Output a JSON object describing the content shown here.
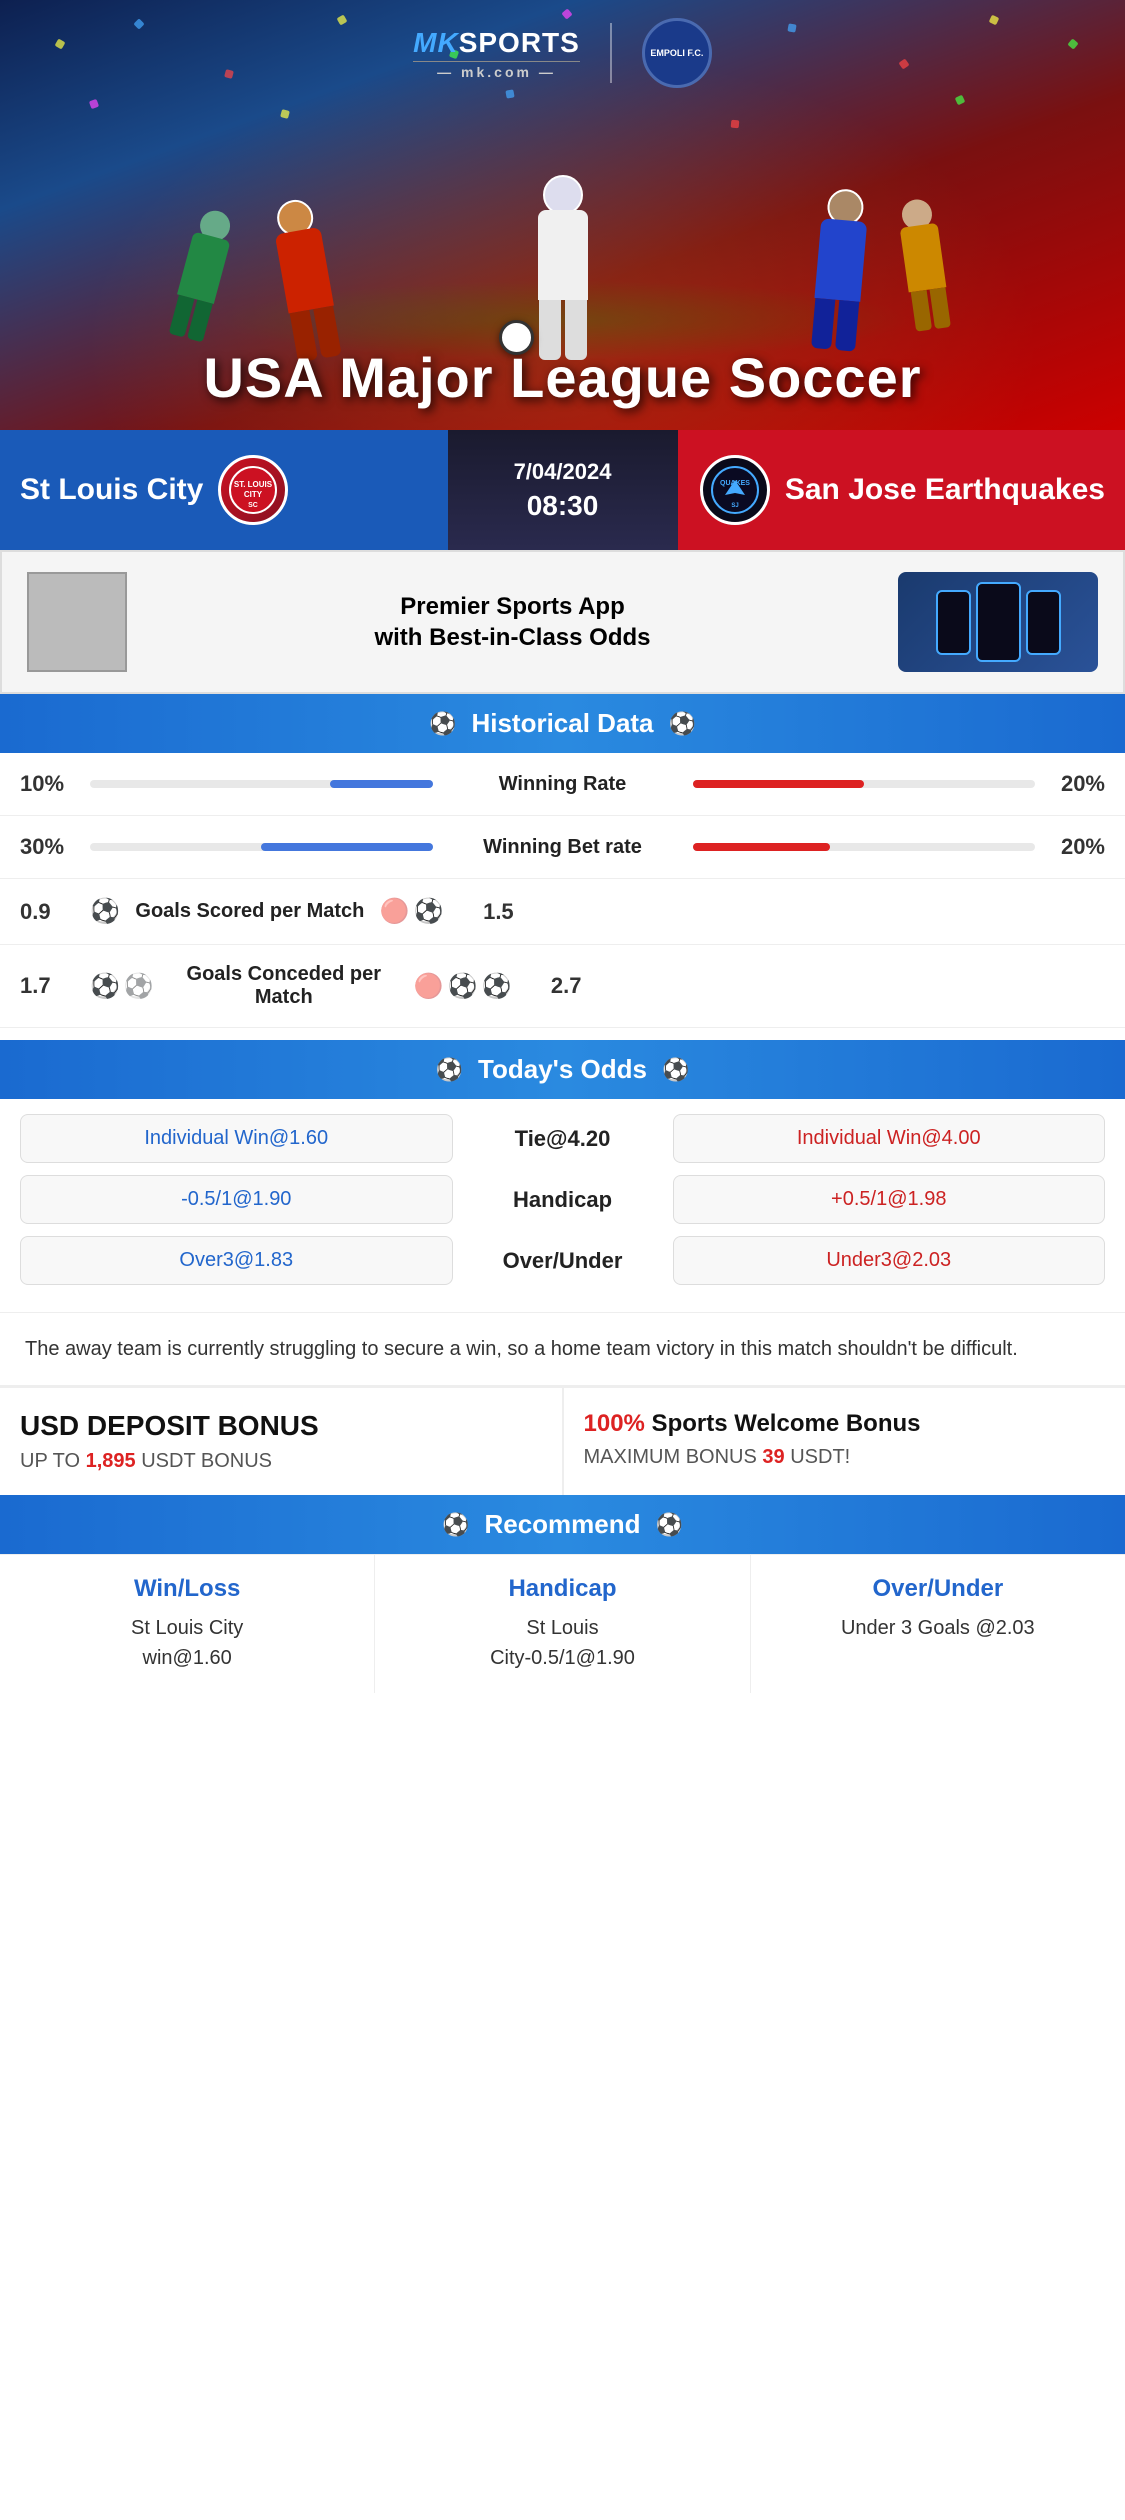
{
  "brand": {
    "name": "MKSPORTS",
    "mk": "MK",
    "sports": "SPORTS",
    "url": "mk.com",
    "partner": "EMPOLI F.C."
  },
  "hero": {
    "title": "USA Major League Soccer"
  },
  "match": {
    "date": "7/04/2024",
    "time": "08:30",
    "home_team": "St Louis City",
    "away_team": "San Jose Earthquakes",
    "away_abbr": "QUAKES"
  },
  "app_promo": {
    "text": "Premier Sports App\nwith Best-in-Class Odds"
  },
  "sections": {
    "historical": "Historical Data",
    "odds": "Today's Odds",
    "recommend": "Recommend"
  },
  "historical_stats": [
    {
      "label": "Winning Rate",
      "left_value": "10%",
      "right_value": "20%",
      "left_pct": 30,
      "right_pct": 50,
      "type": "bar"
    },
    {
      "label": "Winning Bet rate",
      "left_value": "30%",
      "right_value": "20%",
      "left_pct": 50,
      "right_pct": 40,
      "type": "bar"
    },
    {
      "label": "Goals Scored per Match",
      "left_value": "0.9",
      "right_value": "1.5",
      "left_balls": 1,
      "right_balls": 2,
      "type": "icon"
    },
    {
      "label": "Goals Conceded per Match",
      "left_value": "1.7",
      "right_value": "2.7",
      "left_balls": 2,
      "right_balls": 3,
      "type": "icon"
    }
  ],
  "odds": {
    "tie_label": "Tie@4.20",
    "handicap_label": "Handicap",
    "overunder_label": "Over/Under",
    "home_win": "Individual Win@1.60",
    "home_handicap": "-0.5/1@1.90",
    "home_over": "Over3@1.83",
    "away_win": "Individual Win@4.00",
    "away_handicap": "+0.5/1@1.98",
    "away_under": "Under3@2.03"
  },
  "analysis": "The away team is currently struggling to secure a win, so a home team victory in this match shouldn't be difficult.",
  "bonus": {
    "left_title": "USD DEPOSIT BONUS",
    "left_sub": "UP TO",
    "left_amount": "1,895",
    "left_unit": "USDT BONUS",
    "right_title_red": "100%",
    "right_title_black": " Sports Welcome Bonus",
    "right_sub": "MAXIMUM BONUS",
    "right_amount": "39",
    "right_unit": "USDT!"
  },
  "recommend": [
    {
      "title": "Win/Loss",
      "body": "St Louis City\nwin@1.60"
    },
    {
      "title": "Handicap",
      "body": "St Louis\nCity-0.5/1@1.90"
    },
    {
      "title": "Over/Under",
      "body": "Under 3 Goals @2.03"
    }
  ]
}
